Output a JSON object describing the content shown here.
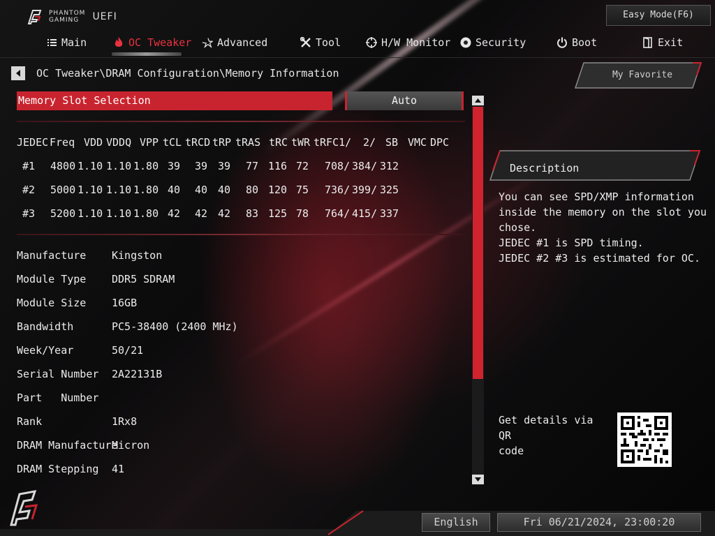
{
  "header": {
    "brand_line1": "PHANTOM",
    "brand_line2": "GAMING",
    "brand_uefi": "UEFI",
    "easy_mode_label": "Easy Mode(F6)"
  },
  "nav": {
    "tabs": [
      {
        "label": "Main",
        "icon": "list-icon"
      },
      {
        "label": "OC Tweaker",
        "icon": "flame-icon",
        "active": true
      },
      {
        "label": "Advanced",
        "icon": "star-icon"
      },
      {
        "label": "Tool",
        "icon": "tools-icon"
      },
      {
        "label": "H/W Monitor",
        "icon": "monitor-crosshair-icon"
      },
      {
        "label": "Security",
        "icon": "shield-gear-icon"
      },
      {
        "label": "Boot",
        "icon": "power-icon"
      },
      {
        "label": "Exit",
        "icon": "exit-door-icon"
      }
    ]
  },
  "breadcrumb": "OC Tweaker\\DRAM Configuration\\Memory Information",
  "favorite_label": "My Favorite",
  "slot_selection": {
    "label": "Memory Slot Selection",
    "value": "Auto"
  },
  "timing_table": {
    "headers": [
      "JEDEC",
      "Freq",
      "VDD",
      "VDDQ",
      "VPP",
      "tCL",
      "tRCD",
      "tRP",
      "tRAS",
      "tRC",
      "tWR",
      "tRFC1/",
      "2/",
      "SB",
      "VMC",
      "DPC"
    ],
    "rows": [
      [
        "#1",
        "4800",
        "1.10",
        "1.10",
        "1.80",
        "39",
        "39",
        "39",
        "77",
        "116",
        "72",
        "708/",
        "384/",
        "312",
        "",
        ""
      ],
      [
        "#2",
        "5000",
        "1.10",
        "1.10",
        "1.80",
        "40",
        "40",
        "40",
        "80",
        "120",
        "75",
        "736/",
        "399/",
        "325",
        "",
        ""
      ],
      [
        "#3",
        "5200",
        "1.10",
        "1.10",
        "1.80",
        "42",
        "42",
        "42",
        "83",
        "125",
        "78",
        "764/",
        "415/",
        "337",
        "",
        ""
      ]
    ]
  },
  "memory_info": [
    {
      "key": "Manufacture",
      "value": "Kingston"
    },
    {
      "key": "Module Type",
      "value": "DDR5 SDRAM"
    },
    {
      "key": "Module Size",
      "value": "16GB"
    },
    {
      "key": "Bandwidth",
      "value": "PC5-38400 (2400 MHz)"
    },
    {
      "key": "Week/Year",
      "value": "50/21"
    },
    {
      "key": "Serial Number",
      "value": "2A22131B"
    },
    {
      "key": "Part   Number",
      "value": ""
    },
    {
      "key": "Rank",
      "value": "1Rx8"
    },
    {
      "key": "DRAM Manufacture",
      "value": "Micron"
    },
    {
      "key": "DRAM Stepping",
      "value": "41"
    }
  ],
  "description": {
    "title": "Description",
    "lines": [
      "You can see SPD/XMP information",
      "inside the memory on the slot you",
      "chose.",
      "JEDEC #1 is SPD timing.",
      "JEDEC #2 #3 is estimated for OC."
    ],
    "qr_lines": [
      "Get details via QR",
      "code"
    ]
  },
  "footer": {
    "language": "English",
    "datetime": "Fri 06/21/2024, 23:00:20"
  },
  "colors": {
    "accent": "#c8242f",
    "active_tab": "#e8323f",
    "background": "#0e0e0f"
  }
}
